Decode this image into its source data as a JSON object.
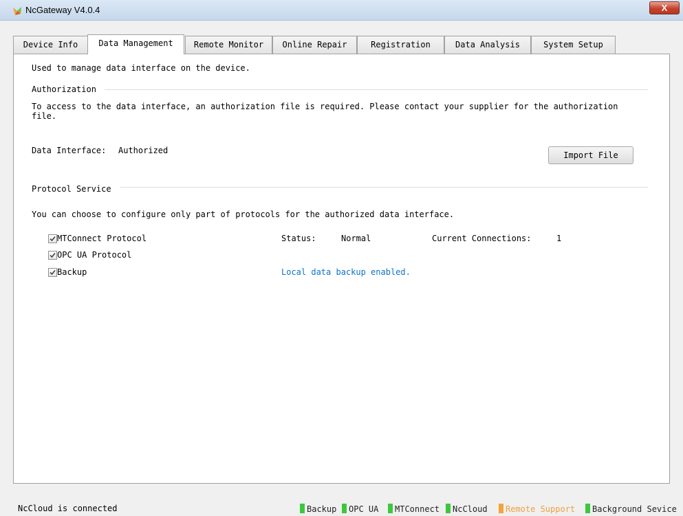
{
  "window": {
    "title": "NcGateway V4.0.4",
    "close_label": "X"
  },
  "tabs": [
    {
      "label": "Device Info",
      "active": false
    },
    {
      "label": "Data Management",
      "active": true
    },
    {
      "label": "Remote Monitor",
      "active": false
    },
    {
      "label": "Online Repair",
      "active": false
    },
    {
      "label": "Registration",
      "active": false
    },
    {
      "label": "Data Analysis",
      "active": false
    },
    {
      "label": "System Setup",
      "active": false
    }
  ],
  "panel": {
    "intro": "Used to manage data interface on the device.",
    "authorization": {
      "heading": "Authorization",
      "description_line1": "To access to the data interface, an authorization file is required. Please contact your supplier for the authorization",
      "description_line2": "file.",
      "interface_label": "Data Interface:",
      "interface_value": "Authorized",
      "import_button": "Import File"
    },
    "protocol": {
      "heading": "Protocol Service",
      "description": "You can choose to configure only part of protocols for the authorized data interface.",
      "items": [
        {
          "label": "MTConnect Protocol",
          "checked": true
        },
        {
          "label": "OPC UA Protocol",
          "checked": true
        },
        {
          "label": "Backup",
          "checked": true
        }
      ],
      "status_label": "Status:",
      "status_value": "Normal",
      "connections_label": "Current Connections:",
      "connections_value": "1",
      "backup_note": "Local data backup enabled."
    }
  },
  "statusbar": {
    "text": "NcCloud is connected",
    "indicators": [
      {
        "label": "Backup",
        "color": "#3cc83c",
        "text_color": "#222222"
      },
      {
        "label": "OPC UA",
        "color": "#3cc83c",
        "text_color": "#222222"
      },
      {
        "label": "MTConnect",
        "color": "#3cc83c",
        "text_color": "#222222"
      },
      {
        "label": "NcCloud",
        "color": "#3cc83c",
        "text_color": "#222222"
      },
      {
        "label": "Remote Support",
        "color": "#f6a23a",
        "text_color": "#f0a040"
      },
      {
        "label": "Background Sevice",
        "color": "#3cc83c",
        "text_color": "#222222"
      }
    ]
  },
  "colors": {
    "accent_blue": "#0b72c8",
    "status_green": "#3cc83c",
    "status_orange": "#f6a23a"
  },
  "icons": {
    "app": "gateway-logo-icon",
    "check": "checkmark-icon"
  }
}
